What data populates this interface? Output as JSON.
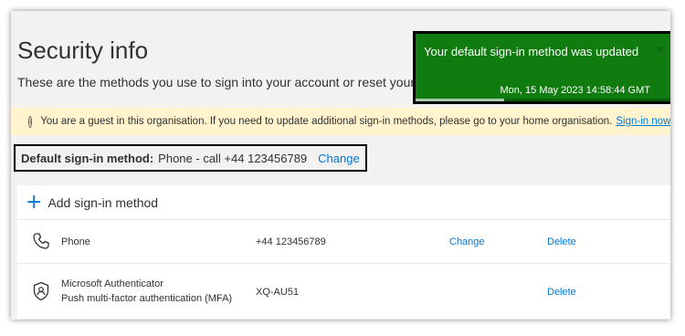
{
  "page": {
    "title": "Security info",
    "subtitle": "These are the methods you use to sign into your account or reset your password."
  },
  "guest_banner": {
    "icon": "info-icon",
    "text": "You are a guest in this organisation. If you need to update additional sign-in methods, please go to your home organisation.",
    "link": "Sign-in now."
  },
  "default_method": {
    "label": "Default sign-in method:",
    "value": "Phone - call +44  123456789",
    "change": "Change"
  },
  "add_method": {
    "icon": "plus-icon",
    "label": "Add sign-in method"
  },
  "methods": [
    {
      "icon": "phone-icon",
      "name": "Phone",
      "detail": "",
      "value": "+44  123456789",
      "change": "Change",
      "delete": "Delete"
    },
    {
      "icon": "authenticator-icon",
      "name": "Microsoft Authenticator",
      "detail": "Push multi-factor authentication (MFA)",
      "value": "XQ-AU51",
      "change": "",
      "delete": "Delete"
    }
  ],
  "toast": {
    "message": "Your default sign-in method was updated",
    "timestamp": "Mon, 15 May 2023 14:58:44 GMT",
    "close": "×",
    "progress_percent": 34,
    "color": "#107c10"
  },
  "colors": {
    "accent": "#0078d4",
    "banner_bg": "#fff4ce",
    "toast_bg": "#107c10"
  }
}
